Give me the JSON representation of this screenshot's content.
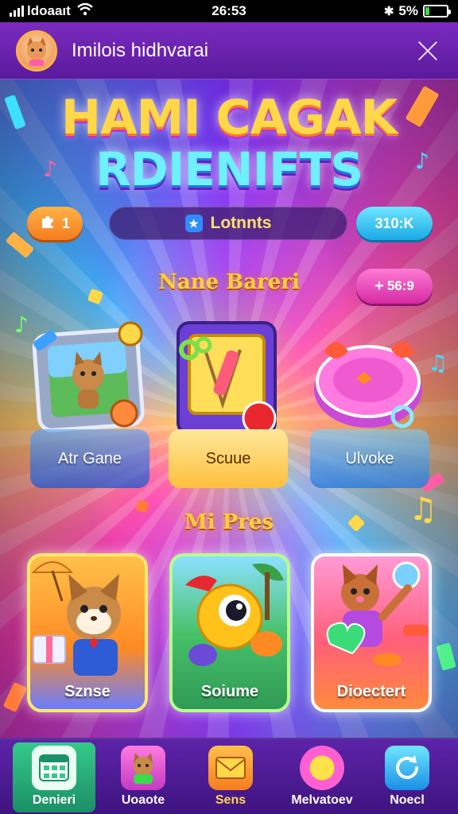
{
  "status_bar": {
    "carrier": "ldoaaıt",
    "time": "26:53",
    "battery": "5%",
    "battery_level": 0.2
  },
  "header": {
    "title": "Imilois hidhvarai",
    "avatar_icon": "cat-avatar-icon",
    "close_icon": "close-icon"
  },
  "game_title": {
    "line1": "HAMI CAGAK",
    "line2": "RDIENIFTS"
  },
  "stats": {
    "left_value": "1",
    "center_label": "Lotnnts",
    "right_value": "310:K"
  },
  "section_one": {
    "title": "Nane Bareri",
    "score": "56:9"
  },
  "games": [
    {
      "label": "Atr Gane",
      "icon": "cat-photo-frame-icon"
    },
    {
      "label": "Scuue",
      "icon": "paint-brush-icon"
    },
    {
      "label": "Ulvoke",
      "icon": "music-drum-icon"
    }
  ],
  "section_two": {
    "title": "Mi Pres"
  },
  "prizes": [
    {
      "label": "Sznse",
      "icon": "cat-gift-icon"
    },
    {
      "label": "Soiume",
      "icon": "yellow-creature-icon"
    },
    {
      "label": "Dioectert",
      "icon": "cat-heart-icon"
    }
  ],
  "bottom_nav": [
    {
      "label": "Denieri",
      "icon": "calendar-grid-icon",
      "active": true
    },
    {
      "label": "Uoaote",
      "icon": "cat-badge-icon",
      "active": false
    },
    {
      "label": "Sens",
      "icon": "envelope-icon",
      "active": false
    },
    {
      "label": "Melvatoev",
      "icon": "orb-button-icon",
      "active": false
    },
    {
      "label": "Noecl",
      "icon": "refresh-icon",
      "active": false
    }
  ],
  "colors": {
    "accent_gold": "#ffcf3f",
    "header_purple": "#6a22b0",
    "active_green": "#2bb37a"
  }
}
